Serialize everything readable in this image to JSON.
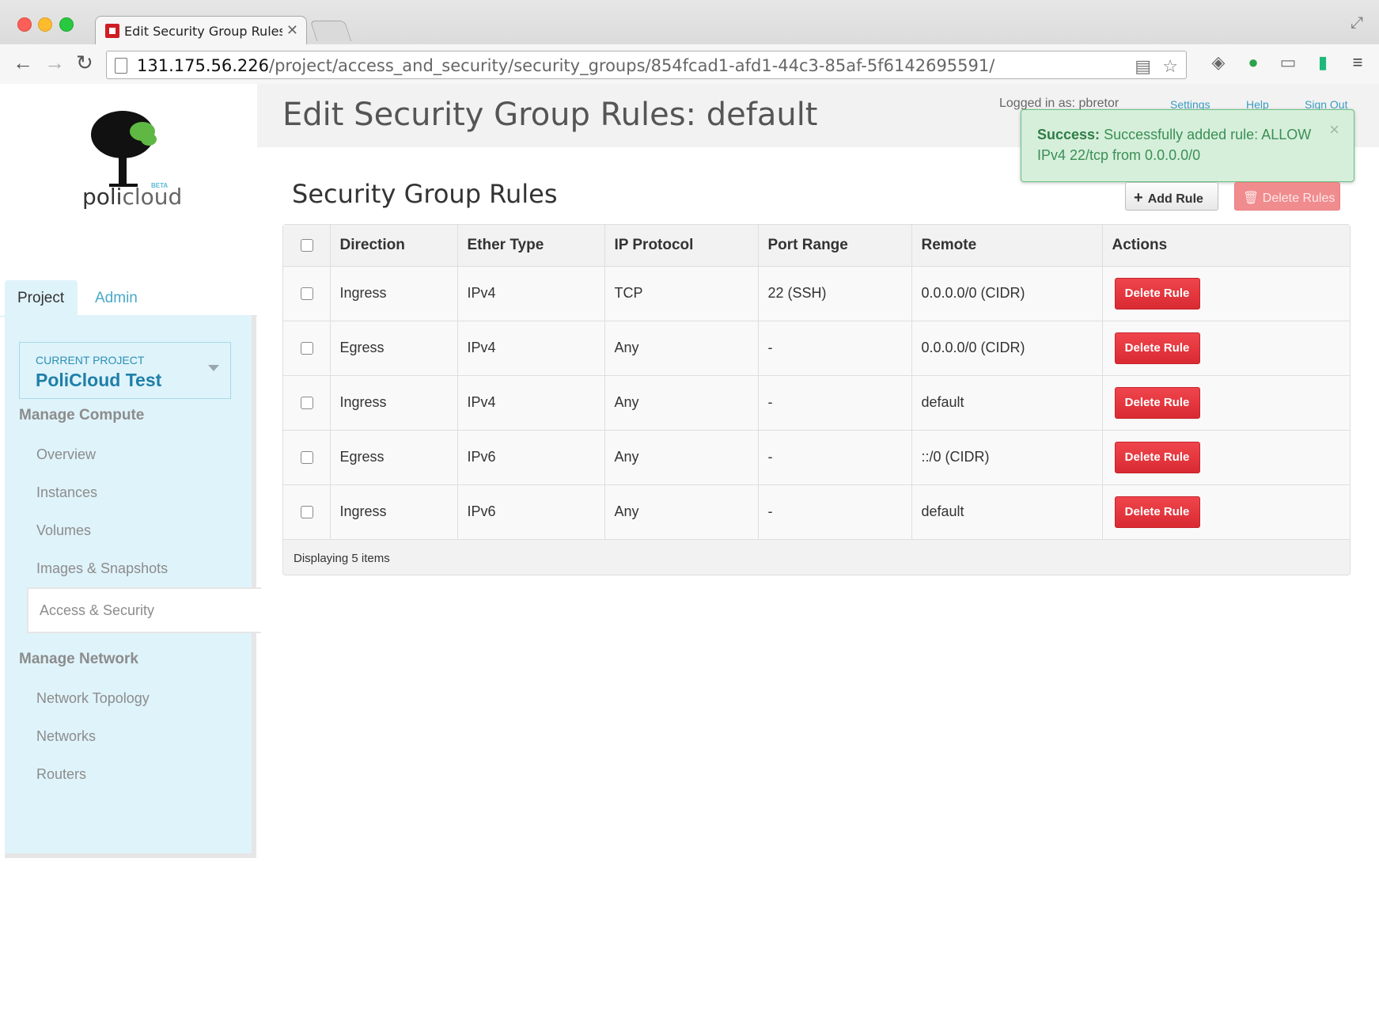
{
  "browser": {
    "tab_title": "Edit Security Group Rules -",
    "url_host": "131.175.56.226",
    "url_path": "/project/access_and_security/security_groups/854fcad1-afd1-44c3-85af-5f6142695591/"
  },
  "brand": {
    "logo_text_a": "poli",
    "logo_text_b": "cloud",
    "beta": "BETA"
  },
  "sidebar": {
    "tabs": [
      {
        "label": "Project"
      },
      {
        "label": "Admin"
      }
    ],
    "current_project_label": "CURRENT PROJECT",
    "current_project_name": "PoliCloud Test",
    "sections": [
      {
        "header": "Manage Compute",
        "items": [
          {
            "label": "Overview"
          },
          {
            "label": "Instances"
          },
          {
            "label": "Volumes"
          },
          {
            "label": "Images & Snapshots"
          },
          {
            "label": "Access & Security"
          }
        ]
      },
      {
        "header": "Manage Network",
        "items": [
          {
            "label": "Network Topology"
          },
          {
            "label": "Networks"
          },
          {
            "label": "Routers"
          }
        ]
      }
    ]
  },
  "header": {
    "title": "Edit Security Group Rules: default",
    "logged_in": "Logged in as: pbretor",
    "links": {
      "settings": "Settings",
      "help": "Help",
      "sign_out": "Sign Out"
    }
  },
  "alert": {
    "strong": "Success:",
    "message": "Successfully added rule: ALLOW IPv4 22/tcp from 0.0.0.0/0",
    "close": "×"
  },
  "section": {
    "title": "Security Group Rules",
    "add_rule": "Add Rule",
    "delete_rules": "Delete Rules"
  },
  "table": {
    "columns": [
      "Direction",
      "Ether Type",
      "IP Protocol",
      "Port Range",
      "Remote",
      "Actions"
    ],
    "rows": [
      {
        "direction": "Ingress",
        "ether": "IPv4",
        "protocol": "TCP",
        "port": "22 (SSH)",
        "remote": "0.0.0.0/0 (CIDR)",
        "action": "Delete Rule"
      },
      {
        "direction": "Egress",
        "ether": "IPv4",
        "protocol": "Any",
        "port": "-",
        "remote": "0.0.0.0/0 (CIDR)",
        "action": "Delete Rule"
      },
      {
        "direction": "Ingress",
        "ether": "IPv4",
        "protocol": "Any",
        "port": "-",
        "remote": "default",
        "action": "Delete Rule"
      },
      {
        "direction": "Egress",
        "ether": "IPv6",
        "protocol": "Any",
        "port": "-",
        "remote": "::/0 (CIDR)",
        "action": "Delete Rule"
      },
      {
        "direction": "Ingress",
        "ether": "IPv6",
        "protocol": "Any",
        "port": "-",
        "remote": "default",
        "action": "Delete Rule"
      }
    ],
    "footer": "Displaying 5 items"
  },
  "colors": {
    "accent": "#1e7fa8",
    "danger": "#e0323a",
    "success_bg": "#d6efdb",
    "sidebar_bg": "#dff3fa"
  }
}
